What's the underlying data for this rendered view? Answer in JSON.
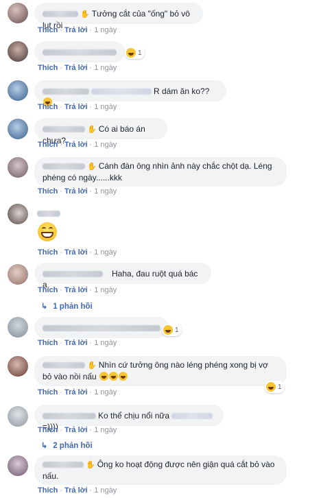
{
  "actions": {
    "like": "Thích",
    "reply": "Trả lời",
    "sep": "·",
    "time": "1 ngày"
  },
  "comments": [
    {
      "text": "Tưởng cắt của \"ống\" bỏ vô lụt rồi"
    },
    {
      "text": "",
      "reaction_count": "1"
    },
    {
      "text": "R dám ăn ko??"
    },
    {
      "text": "Có ai báo án chưa?"
    },
    {
      "text": "Cánh đàn ông nhìn ảnh này chắc chột dạ. Léng phéng có ngày......kkk"
    },
    {
      "text": ""
    },
    {
      "text": "Haha, đau ruột quá bác ạ",
      "replies": "1 phản hồi"
    },
    {
      "text": "",
      "reaction_count": "1"
    },
    {
      "text": "Nhìn cứ tưởng ông nào léng phéng xong bị vợ bỏ vào nồi nấu",
      "reaction_count": "1"
    },
    {
      "text": "Ko thể chịu nổi nữa",
      "text_after": "=))))",
      "replies": "2 phản hồi"
    },
    {
      "text": "Ông ko hoạt động được nên giận quá cắt bỏ vào nấu."
    }
  ],
  "icons": {
    "reaction": "laughing-face-icon",
    "replies_arrow": "reply-arrow-icon",
    "verified": "hand-wave-icon"
  },
  "colors": {
    "link": "#4267b2",
    "bubble": "#f2f3f5",
    "meta": "#90949c"
  }
}
